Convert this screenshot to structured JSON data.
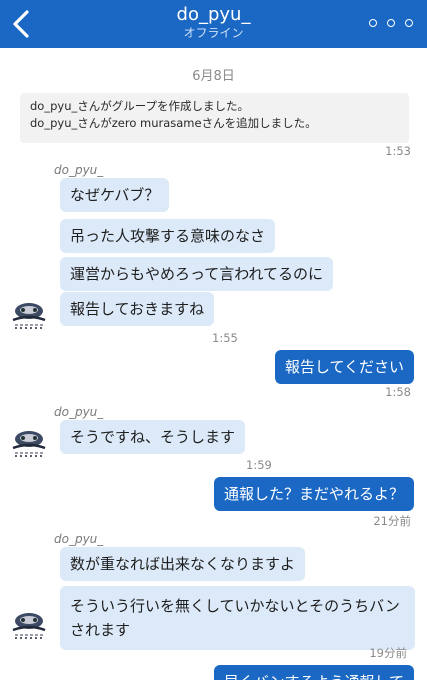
{
  "header": {
    "title": "do_pyu_",
    "status": "オフライン",
    "back_icon": "chevron-left-icon",
    "more_icon": "more-icon"
  },
  "chat": {
    "date": "6月8日",
    "system_messages": [
      "do_pyu_さんがグループを作成しました。",
      "do_pyu_さんがzero murasameさんを追加しました。"
    ],
    "system_time": "1:53",
    "groups": [
      {
        "sender": "do_pyu_",
        "messages": [
          "なぜケバブ？",
          "吊った人攻撃する意味のなさ",
          "運営からもやめろって言われてるのに",
          "報告しておきますね"
        ],
        "time": "1:55"
      },
      {
        "outgoing": "報告してください",
        "time": "1:58"
      },
      {
        "sender": "do_pyu_",
        "messages": [
          "そうですね、そうします"
        ],
        "time": "1:59"
      },
      {
        "outgoing": "通報した？まだやれるよ？",
        "time": "21分前"
      },
      {
        "sender": "do_pyu_",
        "messages": [
          "数が重なれば出来なくなりますよ",
          "そういう行いを無くしていかないとそのうちバンされます"
        ],
        "time": "19分前"
      },
      {
        "outgoing": "早くバンするよう通報して"
      }
    ]
  },
  "colors": {
    "header_bg": "#1a68c4",
    "incoming_bubble": "#dce9f8",
    "outgoing_bubble": "#1a68c4"
  }
}
